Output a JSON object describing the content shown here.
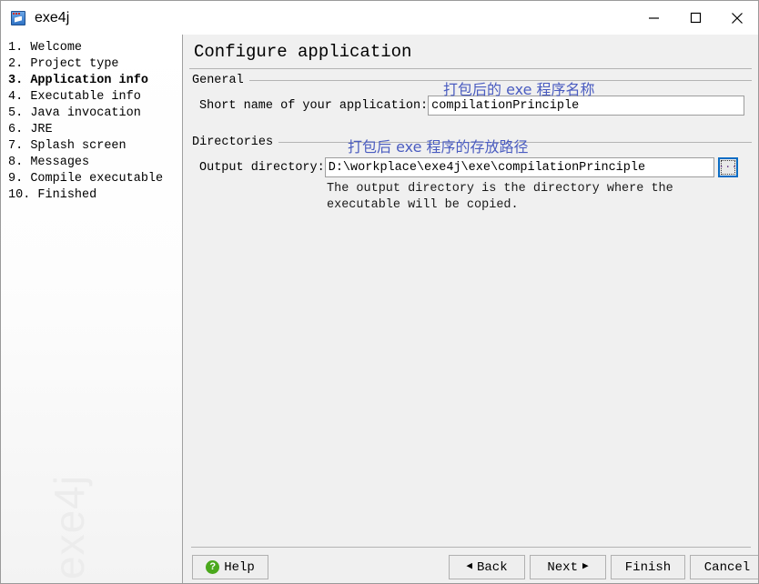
{
  "window": {
    "title": "exe4j",
    "icon": "app-window-icon",
    "controls": {
      "minimize": "minimize-icon",
      "maximize": "maximize-icon",
      "close": "close-icon"
    }
  },
  "sidebar": {
    "watermark": "exe4j",
    "steps": [
      {
        "num": "1.",
        "label": "Welcome",
        "active": false
      },
      {
        "num": "2.",
        "label": "Project type",
        "active": false
      },
      {
        "num": "3.",
        "label": "Application info",
        "active": true
      },
      {
        "num": "4.",
        "label": "Executable info",
        "active": false
      },
      {
        "num": "5.",
        "label": "Java invocation",
        "active": false
      },
      {
        "num": "6.",
        "label": "JRE",
        "active": false
      },
      {
        "num": "7.",
        "label": "Splash screen",
        "active": false
      },
      {
        "num": "8.",
        "label": "Messages",
        "active": false
      },
      {
        "num": "9.",
        "label": "Compile executable",
        "active": false
      },
      {
        "num": "10.",
        "label": "Finished",
        "active": false
      }
    ]
  },
  "main": {
    "heading": "Configure application",
    "groups": {
      "general": {
        "title": "General",
        "short_name_label": "Short name of your application:",
        "short_name_value": "compilationPrinciple"
      },
      "directories": {
        "title": "Directories",
        "output_dir_label": "Output directory:",
        "output_dir_value": "D:\\workplace\\exe4j\\exe\\compilationPrinciple",
        "browse_label": "...",
        "output_dir_hint": "The output directory is the directory where the\nexecutable will be copied."
      }
    },
    "annotations": {
      "name_note": "打包后的 exe 程序名称",
      "path_note": "打包后 exe 程序的存放路径",
      "color": "#4a5cc0"
    }
  },
  "footer": {
    "help": "Help",
    "back": "Back",
    "back_arrow": "◀",
    "next": "Next",
    "next_arrow": "▶",
    "finish": "Finish",
    "cancel": "Cancel",
    "help_icon_color": "#4aa81c"
  }
}
